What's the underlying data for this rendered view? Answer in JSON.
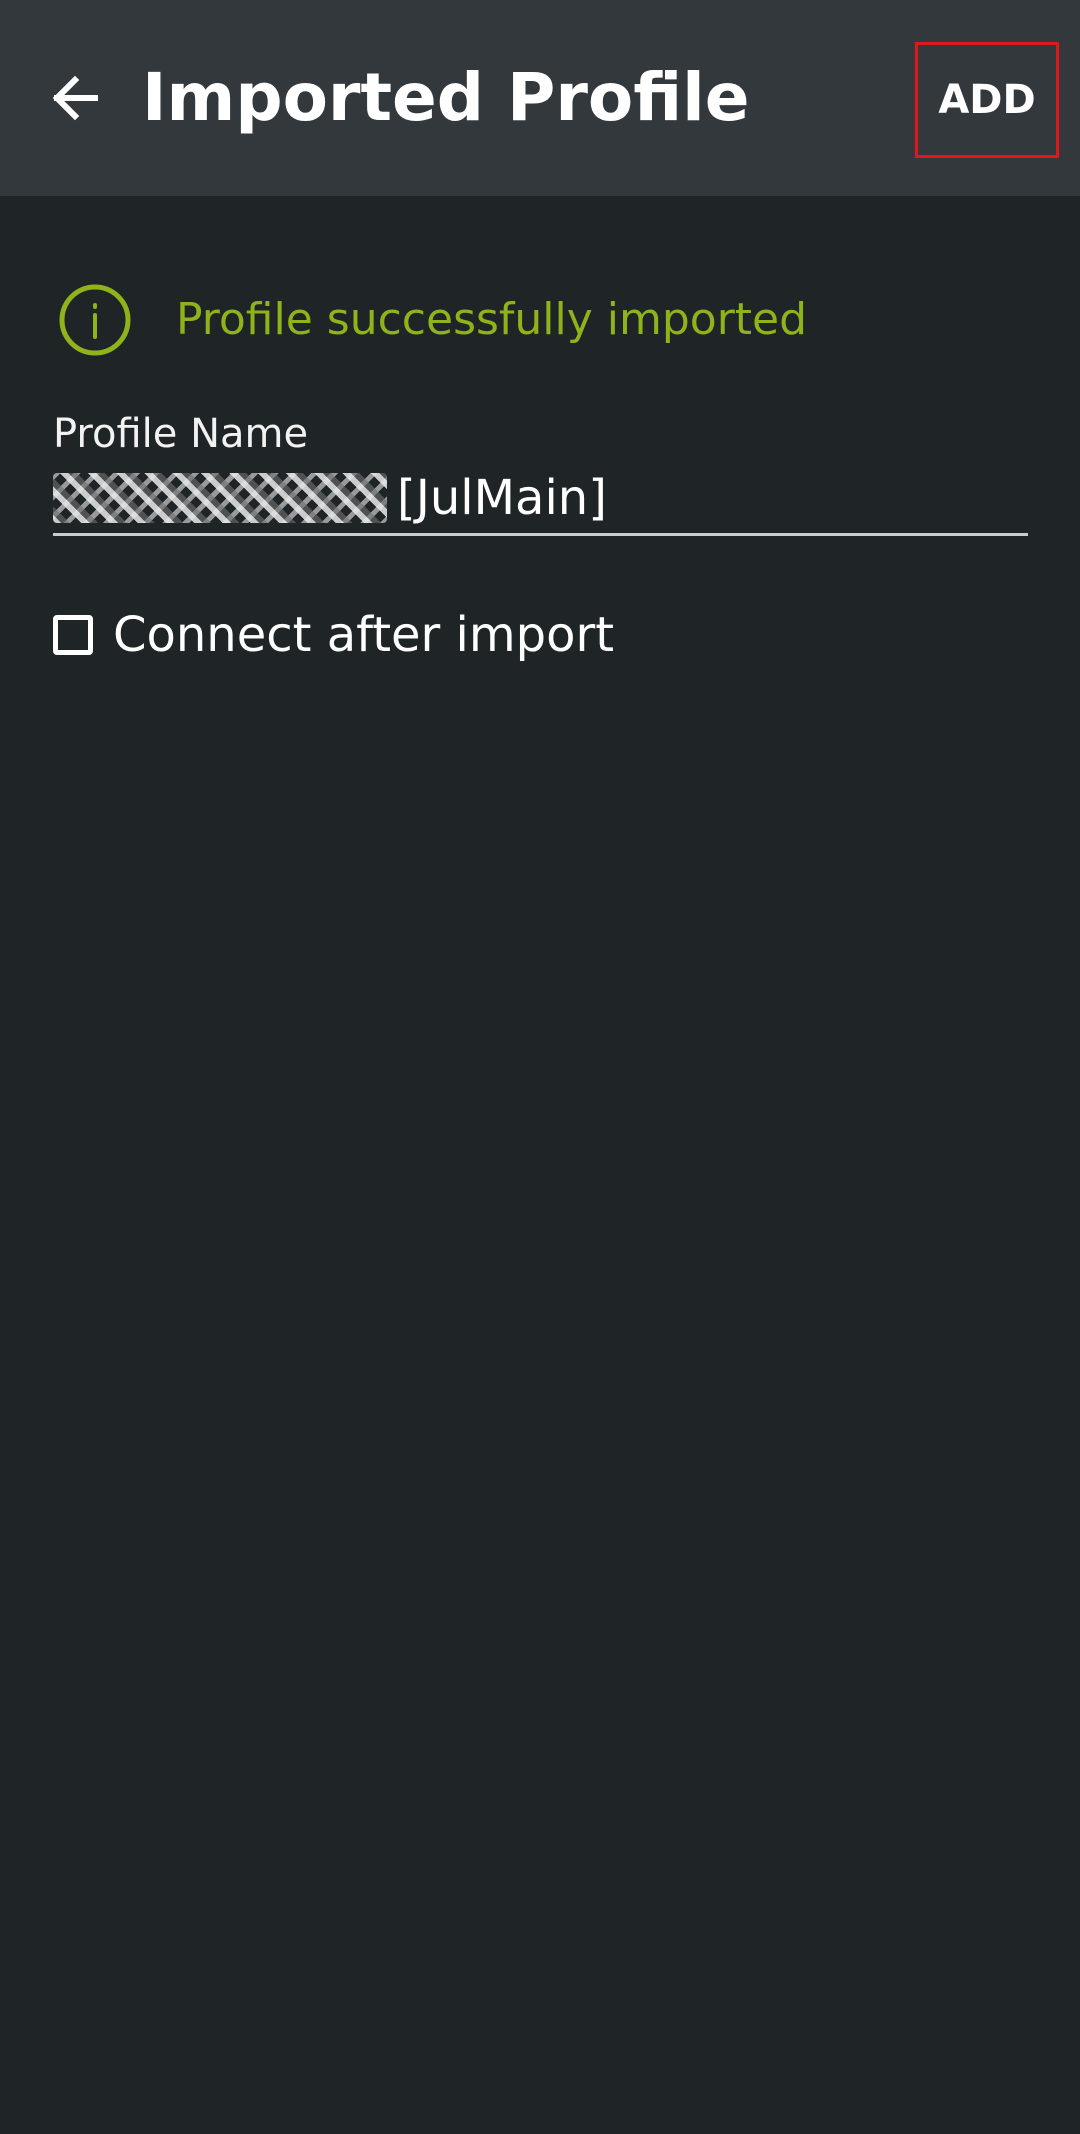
{
  "app_bar": {
    "title": "Imported Profile",
    "back_icon": "arrow-left-icon",
    "add_label": "ADD"
  },
  "info": {
    "icon": "info-circle-icon",
    "message": "Profile successfully imported",
    "color": "#8fb31b"
  },
  "profile_name": {
    "label": "Profile Name",
    "value_suffix": "[JulMain]"
  },
  "connect_after_import": {
    "label": "Connect after import",
    "checked": false
  },
  "colors": {
    "background": "#1f2426",
    "app_bar": "#32383b",
    "highlight_border": "#e0161b"
  }
}
